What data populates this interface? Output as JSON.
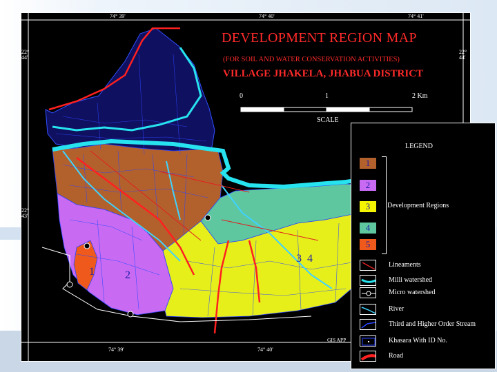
{
  "map": {
    "title": "DEVELOPMENT REGION  MAP",
    "subtitle": "(FOR SOIL AND WATER CONSERVATION ACTIVITIES)",
    "village": "VILLAGE JHAKELA, JHABUA DISTRICT",
    "scale": {
      "zero": "0",
      "mid": "1",
      "end": "2 Km",
      "label": "SCALE"
    },
    "coords": {
      "top_1": "74° 39'",
      "top_2": "74° 40'",
      "top_3": "74° 41'",
      "bottom_1": "74° 39'",
      "bottom_2": "74° 40'",
      "left_1a": "22°",
      "left_1b": "44'",
      "left_2a": "22°",
      "left_2b": "43'",
      "right_1a": "22°",
      "right_1b": "44'"
    },
    "region_labels": [
      "1",
      "2",
      "3",
      "4"
    ],
    "credit": "GIS APP"
  },
  "legend": {
    "title": "LEGEND",
    "regions": [
      {
        "label": "1",
        "color": "#b3612c"
      },
      {
        "label": "2",
        "color": "#c86bf2"
      },
      {
        "label": "3",
        "color": "#f4f400"
      },
      {
        "label": "4",
        "color": "#5ec7a0"
      },
      {
        "label": "5",
        "color": "#ef5a1c"
      }
    ],
    "regions_label": "Development Regions",
    "items": [
      {
        "name": "lineaments",
        "label": "Lineaments",
        "color": "#e02020"
      },
      {
        "name": "milli-watershed",
        "label": "Milli watershed",
        "color": "#27e3ef"
      },
      {
        "name": "micro-watershed",
        "label": "Micro watershed",
        "color": "#ffffff"
      },
      {
        "name": "river",
        "label": "River",
        "color": "#3fd3ff"
      },
      {
        "name": "stream",
        "label": "Third and Higher Order Stream",
        "color": "#2a45ff"
      },
      {
        "name": "khasara",
        "label": "Khasara With ID No.",
        "color": "#2a45ff"
      },
      {
        "name": "road",
        "label": "Road",
        "color": "#ff2020"
      }
    ]
  }
}
